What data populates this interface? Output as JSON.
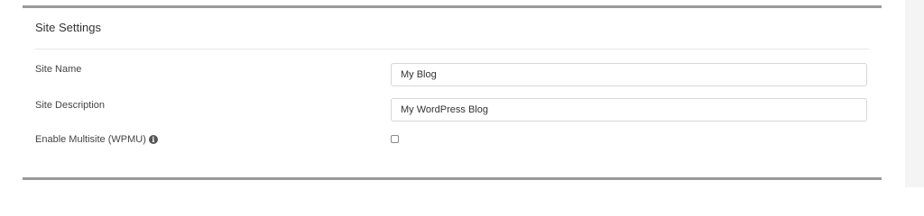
{
  "panel": {
    "title": "Site Settings"
  },
  "fields": {
    "site_name": {
      "label": "Site Name",
      "value": "My Blog"
    },
    "site_description": {
      "label": "Site Description",
      "value": "My WordPress Blog"
    },
    "multisite": {
      "label": "Enable Multisite (WPMU)",
      "info_icon": "info-circle-icon",
      "checked": false
    }
  },
  "colors": {
    "panel_border": "#9a9a9a",
    "divider": "#e6e6e6",
    "gutter": "#f4f4f4"
  }
}
